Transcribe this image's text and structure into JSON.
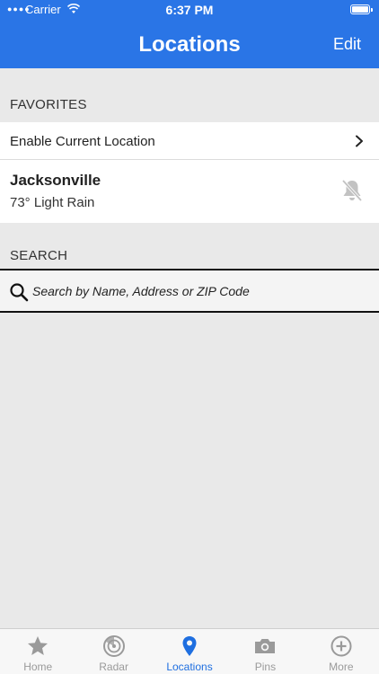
{
  "status_bar": {
    "carrier": "Carrier",
    "time": "6:37 PM",
    "battery_percent": 100
  },
  "nav": {
    "title": "Locations",
    "edit_label": "Edit"
  },
  "favorites": {
    "header": "FAVORITES",
    "enable_current_location": "Enable Current Location",
    "chevron_icon": "chevron-right-icon",
    "locations": [
      {
        "name": "Jacksonville",
        "weather": "73° Light Rain",
        "notification_icon": "bell-off-icon"
      }
    ]
  },
  "search": {
    "header": "SEARCH",
    "placeholder": "Search by Name, Address or ZIP Code",
    "value": "",
    "icon": "search-icon"
  },
  "tabs": [
    {
      "label": "Home",
      "icon": "star-icon",
      "active": false
    },
    {
      "label": "Radar",
      "icon": "radar-icon",
      "active": false
    },
    {
      "label": "Locations",
      "icon": "location-pin-icon",
      "active": true
    },
    {
      "label": "Pins",
      "icon": "camera-icon",
      "active": false
    },
    {
      "label": "More",
      "icon": "plus-circle-icon",
      "active": false
    }
  ],
  "colors": {
    "accent": "#2a75e6",
    "active_tab": "#1f6fe0",
    "inactive_tab": "#9a9a9a",
    "background": "#e9e9e9"
  }
}
